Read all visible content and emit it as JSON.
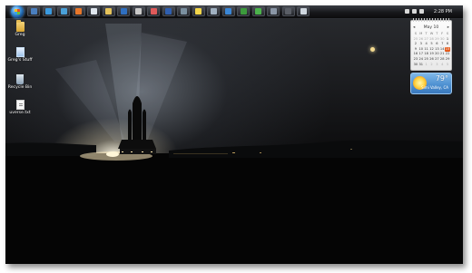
{
  "taskbar": {
    "start_icon": "windows-orb-icon",
    "quick_launch": [
      {
        "name": "show-desktop-icon",
        "color": "#4a7fbf"
      },
      {
        "name": "ie-icon",
        "color": "#3a9ae0"
      },
      {
        "name": "media-player-icon",
        "color": "#4aa0d8"
      },
      {
        "name": "firefox-icon",
        "color": "#e8772a"
      },
      {
        "name": "notepad-icon",
        "color": "#dfe6ee"
      },
      {
        "name": "folder-icon",
        "color": "#e6c35a"
      },
      {
        "name": "outlook-icon",
        "color": "#2f6fc0"
      },
      {
        "name": "calculator-icon",
        "color": "#c9c9c9"
      },
      {
        "name": "paint-icon",
        "color": "#e05a5a"
      },
      {
        "name": "word-icon",
        "color": "#2f5fb0"
      },
      {
        "name": "photo-viewer-icon",
        "color": "#7a8f9f"
      },
      {
        "name": "sticky-notes-icon",
        "color": "#f3d64a"
      },
      {
        "name": "clock-icon",
        "color": "#a0b0c0"
      },
      {
        "name": "writer-icon",
        "color": "#3a86d6"
      },
      {
        "name": "excel-icon",
        "color": "#3c9a3c"
      },
      {
        "name": "messenger-icon",
        "color": "#4cb34c"
      },
      {
        "name": "network-icon",
        "color": "#8a96a6"
      },
      {
        "name": "task-window-icon",
        "color": "#5a5e66"
      },
      {
        "name": "notepad2-icon",
        "color": "#cfd7df"
      }
    ],
    "tray_icons": [
      "action-center-icon",
      "volume-icon",
      "network-tray-icon"
    ],
    "clock": "2:28 PM"
  },
  "desktop_icons": [
    {
      "label": "Greg",
      "icon": "user-folder-icon"
    },
    {
      "label": "Greg's Stuff",
      "icon": "document-folder-icon"
    },
    {
      "label": "Recycle Bin",
      "icon": "recycle-bin-icon"
    },
    {
      "label": "uverse.txt",
      "icon": "text-file-icon"
    }
  ],
  "calendar": {
    "month_label": "May 10",
    "prev": "◂",
    "next": "▸",
    "days_of_week": [
      "S",
      "M",
      "T",
      "W",
      "T",
      "F",
      "S"
    ],
    "weeks": [
      [
        "25",
        "26",
        "27",
        "28",
        "29",
        "30",
        "1"
      ],
      [
        "2",
        "3",
        "4",
        "5",
        "6",
        "7",
        "8"
      ],
      [
        "9",
        "10",
        "11",
        "12",
        "13",
        "14",
        "15"
      ],
      [
        "16",
        "17",
        "18",
        "19",
        "20",
        "21",
        "22"
      ],
      [
        "23",
        "24",
        "25",
        "26",
        "27",
        "28",
        "29"
      ],
      [
        "30",
        "31",
        "1",
        "2",
        "3",
        "4",
        "5"
      ]
    ],
    "today": "15"
  },
  "weather": {
    "temperature": "79°",
    "location": "Simi Valley, CA",
    "condition_icon": "sunny-icon"
  },
  "colors": {
    "accent_today": "#e35a1b",
    "weather_sky": "#4c8fd0"
  }
}
